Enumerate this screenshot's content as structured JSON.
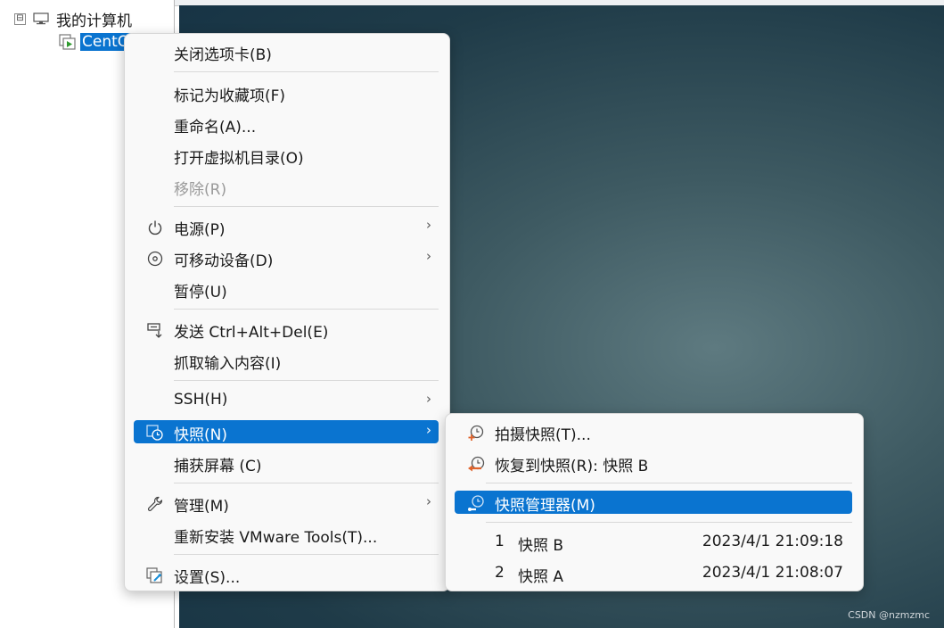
{
  "tree": {
    "root_label": "我的计算机",
    "expander": "⊟",
    "vm_label": "CentOS"
  },
  "main_menu": {
    "close_tab": "关闭选项卡(B)",
    "mark_favorite": "标记为收藏项(F)",
    "rename": "重命名(A)...",
    "open_dir": "打开虚拟机目录(O)",
    "remove": "移除(R)",
    "power": "电源(P)",
    "removable_devices": "可移动设备(D)",
    "pause": "暂停(U)",
    "send_cad": "发送 Ctrl+Alt+Del(E)",
    "grab_input": "抓取输入内容(I)",
    "ssh": "SSH(H)",
    "snapshot": "快照(N)",
    "capture_screen": "捕获屏幕 (C)",
    "manage": "管理(M)",
    "reinstall_tools": "重新安装 VMware Tools(T)...",
    "settings": "设置(S)...",
    "arrow": "›"
  },
  "snapshot_menu": {
    "take_snapshot": "拍摄快照(T)...",
    "revert_snapshot": "恢复到快照(R): 快照 B",
    "snapshot_manager": "快照管理器(M)",
    "snapshots": [
      {
        "num": "1",
        "name": "快照 B",
        "time": "2023/4/1 21:09:18"
      },
      {
        "num": "2",
        "name": "快照 A",
        "time": "2023/4/1 21:08:07"
      }
    ]
  },
  "watermark": "CSDN @nzmzmc",
  "colors": {
    "highlight": "#0a74d0",
    "menu_bg": "#f9f9f9"
  }
}
